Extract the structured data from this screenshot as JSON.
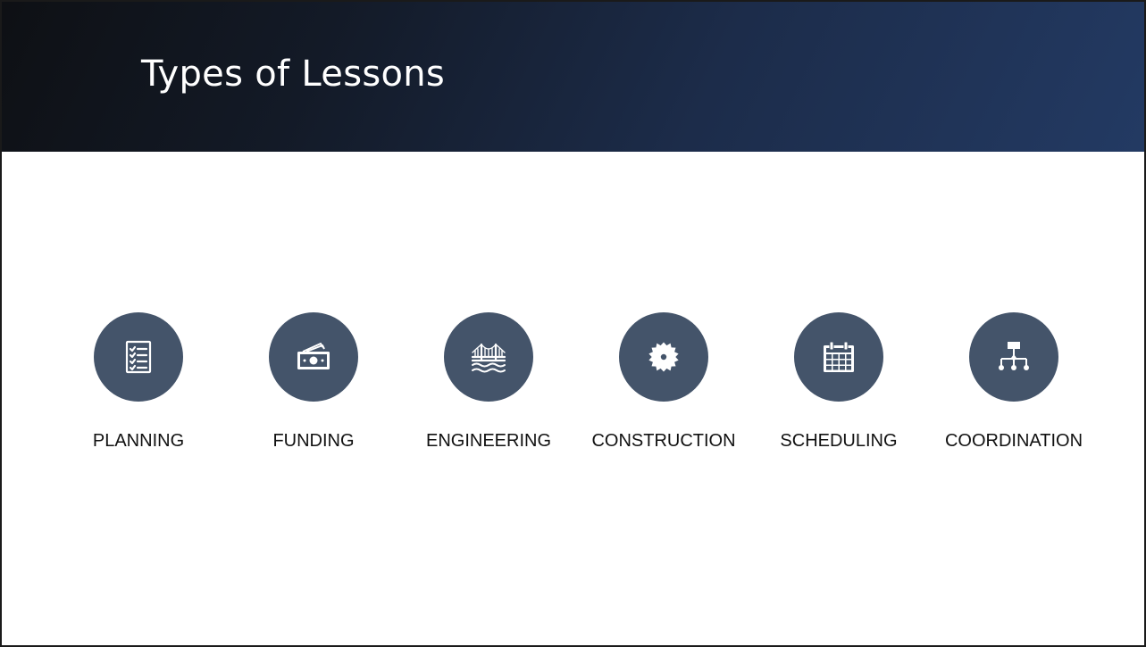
{
  "slide": {
    "title": "Types of Lessons"
  },
  "colors": {
    "header_dark": "#0e1014",
    "header_blue": "#233a63",
    "icon_circle": "#44546a",
    "icon_glyph": "#ffffff",
    "label_text": "#111111"
  },
  "lessons": [
    {
      "label": "PLANNING",
      "icon": "checklist-icon"
    },
    {
      "label": "FUNDING",
      "icon": "money-icon"
    },
    {
      "label": "ENGINEERING",
      "icon": "bridge-icon"
    },
    {
      "label": "CONSTRUCTION",
      "icon": "saw-blade-icon"
    },
    {
      "label": "SCHEDULING",
      "icon": "calendar-icon"
    },
    {
      "label": "COORDINATION",
      "icon": "org-chart-icon"
    }
  ]
}
